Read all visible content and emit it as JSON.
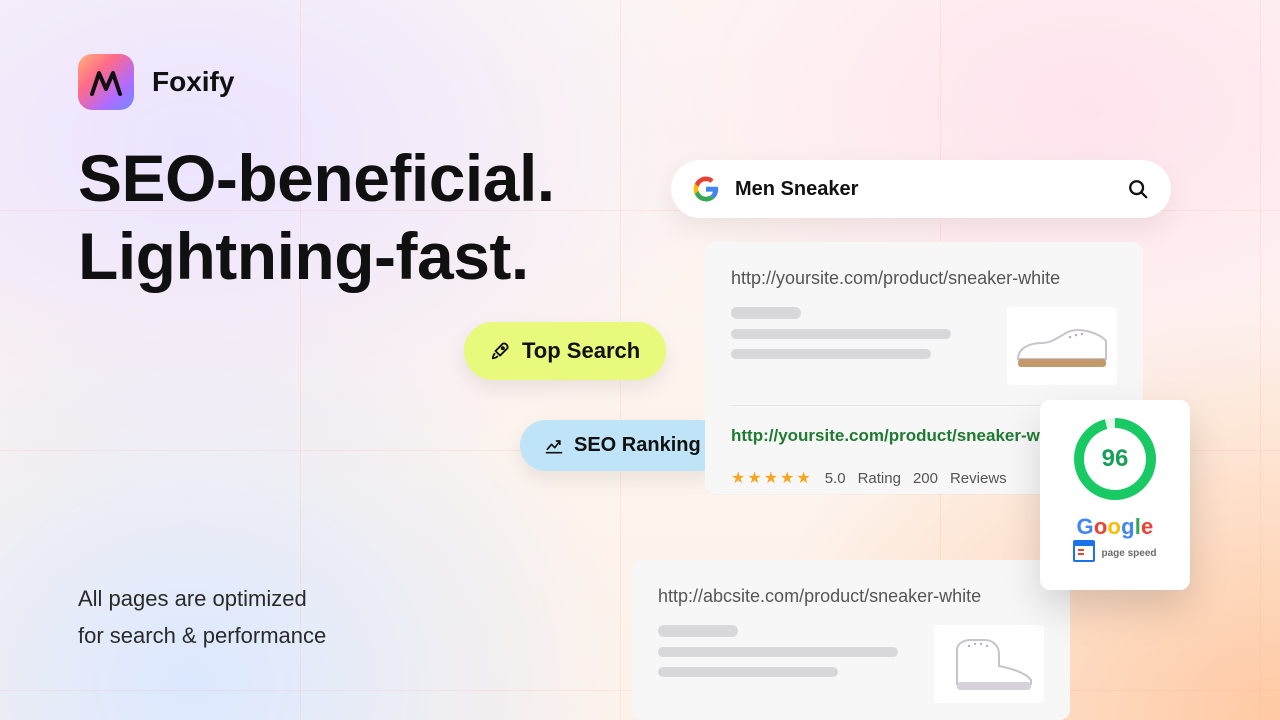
{
  "brand": {
    "name": "Foxify"
  },
  "headline_line1": "SEO-beneficial.",
  "headline_line2": "Lightning-fast.",
  "sub_line1": "All pages are optimized",
  "sub_line2": "for search & performance",
  "badges": {
    "top_search": "Top Search",
    "seo_ranking": "SEO Ranking"
  },
  "search": {
    "query": "Men Sneaker"
  },
  "results": {
    "primary": {
      "url": "http://yoursite.com/product/sneaker-white",
      "url_live": "http://yoursite.com/product/sneaker-white/",
      "rating_value": "5.0",
      "rating_text": "Rating",
      "reviews_count": "200",
      "reviews_text": "Reviews"
    },
    "secondary": {
      "url": "http://abcsite.com/product/sneaker-white"
    }
  },
  "pagespeed": {
    "score": "96",
    "brand": "Google",
    "label": "page speed"
  }
}
